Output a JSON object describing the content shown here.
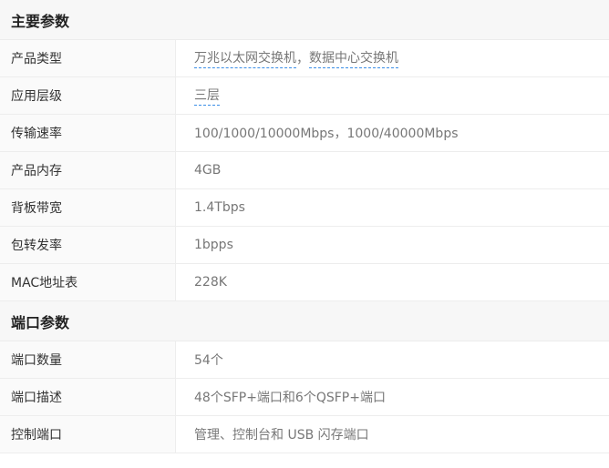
{
  "main_params": {
    "title": "主要参数",
    "rows": [
      {
        "label": "产品类型",
        "value_link1": "万兆以太网交换机",
        "value_sep": "，",
        "value_link2": "数据中心交换机"
      },
      {
        "label": "应用层级",
        "value_link": "三层"
      },
      {
        "label": "传输速率",
        "value": "100/1000/10000Mbps，1000/40000Mbps"
      },
      {
        "label": "产品内存",
        "value": "4GB"
      },
      {
        "label": "背板带宽",
        "value": "1.4Tbps"
      },
      {
        "label": "包转发率",
        "value": "1bpps"
      },
      {
        "label": "MAC地址表",
        "value": "228K"
      }
    ]
  },
  "port_params": {
    "title": "端口参数",
    "rows": [
      {
        "label": "端口数量",
        "value": "54个"
      },
      {
        "label": "端口描述",
        "value": "48个SFP+端口和6个QSFP+端口"
      },
      {
        "label": "控制端口",
        "value": "管理、控制台和 USB 闪存端口"
      }
    ]
  },
  "colors": {
    "link_underline": "#3a8ee6",
    "header_bg": "#f7f7f7",
    "label_bg": "#fafafa"
  }
}
